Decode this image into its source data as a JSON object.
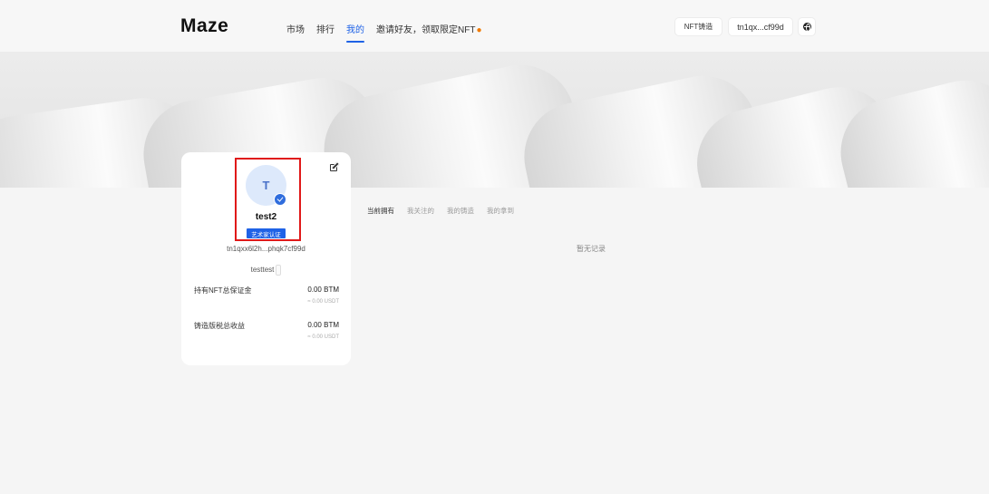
{
  "header": {
    "logo": "Maze",
    "nav": [
      {
        "label": "市场"
      },
      {
        "label": "排行"
      },
      {
        "label": "我的"
      },
      {
        "label": "邀请好友，领取限定NFT"
      }
    ],
    "active_nav_index": 2,
    "mint_button": "NFT铸造",
    "wallet_button": "tn1qx...cf99d",
    "language_icon": "globe-icon",
    "accent_color": "#1f62e6"
  },
  "profile": {
    "avatar_letter": "T",
    "username": "test2",
    "badge": "艺术家认证",
    "address": "tn1qxx6l2h...phqk7cf99d",
    "bio": "testtest",
    "stats": [
      {
        "label": "持有NFT总保证金",
        "value": "0.00 BTM",
        "sub": "≈ 0.00 USDT"
      },
      {
        "label": "铸造版税总收益",
        "value": "0.00 BTM",
        "sub": "≈ 0.00 USDT"
      }
    ]
  },
  "tabs": [
    {
      "label": "当前拥有"
    },
    {
      "label": "我关注的"
    },
    {
      "label": "我的铸造"
    },
    {
      "label": "我的拿到"
    }
  ],
  "active_tab_index": 0,
  "empty_text": "暂无记录"
}
